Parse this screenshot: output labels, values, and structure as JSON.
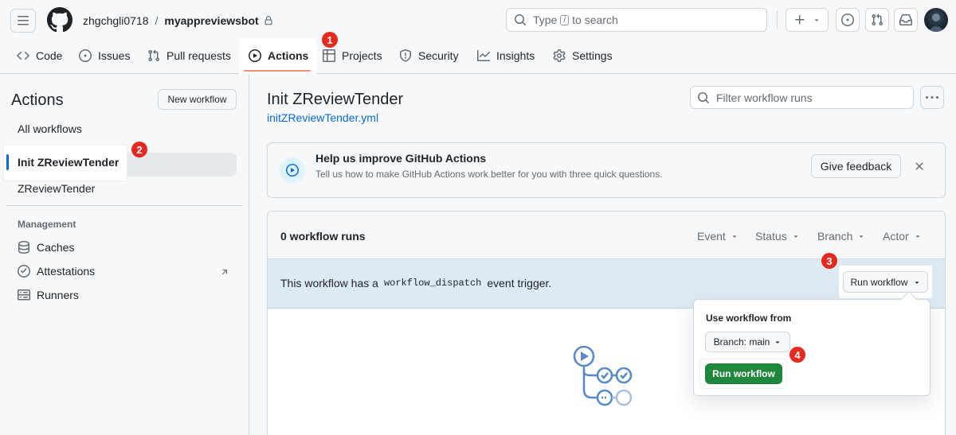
{
  "header": {
    "owner": "zhgchgli0718",
    "separator": "/",
    "repo": "myappreviewsbot",
    "search_prefix": "Type",
    "search_key": "/",
    "search_suffix": "to search",
    "icons": [
      "hamburger-icon",
      "github-logo",
      "lock-icon",
      "search-icon",
      "plus-icon",
      "issues-icon",
      "pull-request-icon",
      "inbox-icon",
      "avatar"
    ]
  },
  "tabs": [
    {
      "label": "Code",
      "icon": "code-icon"
    },
    {
      "label": "Issues",
      "icon": "issue-opened-icon"
    },
    {
      "label": "Pull requests",
      "icon": "git-pull-request-icon"
    },
    {
      "label": "Actions",
      "icon": "play-icon",
      "active": true
    },
    {
      "label": "Projects",
      "icon": "table-icon"
    },
    {
      "label": "Security",
      "icon": "shield-icon"
    },
    {
      "label": "Insights",
      "icon": "graph-icon"
    },
    {
      "label": "Settings",
      "icon": "gear-icon"
    }
  ],
  "callouts": [
    "1",
    "2",
    "3",
    "4"
  ],
  "sidebar": {
    "title": "Actions",
    "new_workflow": "New workflow",
    "all_workflows": "All workflows",
    "workflows": [
      "Init ZReviewTender",
      "ZReviewTender"
    ],
    "management_heading": "Management",
    "management": [
      {
        "label": "Caches",
        "icon": "database-icon"
      },
      {
        "label": "Attestations",
        "icon": "verified-icon"
      },
      {
        "label": "Runners",
        "icon": "server-icon"
      }
    ]
  },
  "main": {
    "title": "Init ZReviewTender",
    "file": "initZReviewTender.yml",
    "filter_placeholder": "Filter workflow runs",
    "feedback": {
      "title": "Help us improve GitHub Actions",
      "description": "Tell us how to make GitHub Actions work better for you with three quick questions.",
      "button": "Give feedback"
    },
    "runs": {
      "count": "0 workflow runs",
      "filters": [
        "Event",
        "Status",
        "Branch",
        "Actor"
      ],
      "dispatch_prefix": "This workflow has a",
      "dispatch_code": "workflow_dispatch",
      "dispatch_suffix": "event trigger.",
      "run_workflow": "Run workflow"
    },
    "popover": {
      "title": "Use workflow from",
      "branch": "Branch: main",
      "run_button": "Run workflow"
    }
  },
  "colors": {
    "accent_blue": "#0969da",
    "active_underline": "#fd8c73",
    "callout_red": "#e5291f",
    "run_green": "#1f883d",
    "dispatch_bg": "#ddeaf3"
  }
}
